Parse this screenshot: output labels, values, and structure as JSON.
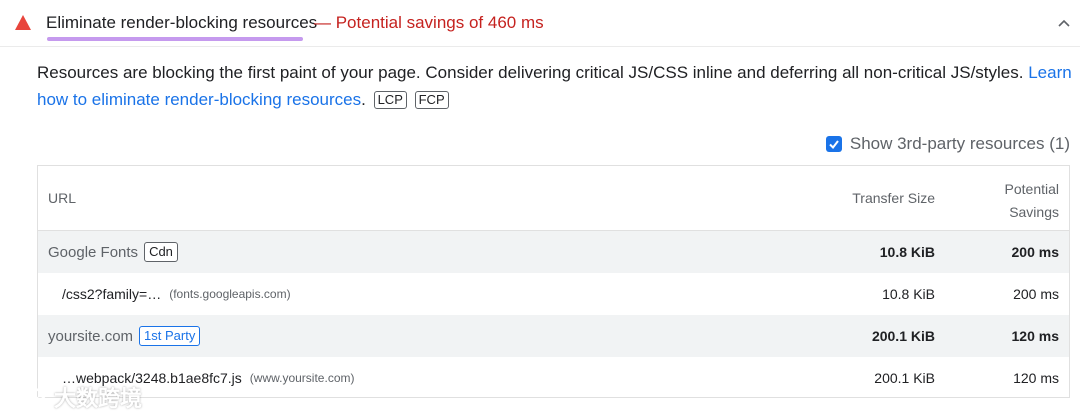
{
  "audit": {
    "title": "Eliminate render-blocking resources",
    "savings": "— Potential savings of 460 ms",
    "colors": {
      "warning": "#e8453c",
      "savings": "#c5221f",
      "underline": "#c59aee",
      "link": "#1a73e8"
    },
    "icons": {
      "status": "warning-triangle-icon",
      "toggle": "chevron-up-icon"
    }
  },
  "description": {
    "text": "Resources are blocking the first paint of your page. Consider delivering critical JS/CSS inline and deferring all non-critical JS/styles.",
    "link": "Learn how to eliminate render-blocking resources",
    "period": ".",
    "badges": [
      "LCP",
      "FCP"
    ]
  },
  "third_party": {
    "label": "Show 3rd-party resources (1)",
    "checked": true
  },
  "table": {
    "headers": {
      "url": "URL",
      "transfer_size": "Transfer Size",
      "savings_line1": "Potential",
      "savings_line2": "Savings"
    },
    "groups": [
      {
        "name": "Google Fonts",
        "badge": "Cdn",
        "transfer_size": "10.8 KiB",
        "savings": "200 ms",
        "items": [
          {
            "path": "/css2?family=…",
            "host": "(fonts.googleapis.com)",
            "transfer_size": "10.8 KiB",
            "savings": "200 ms"
          }
        ]
      },
      {
        "name": "yoursite.com",
        "badge": "1st Party",
        "transfer_size": "200.1 KiB",
        "savings": "120 ms",
        "items": [
          {
            "path": "…webpack/3248.b1ae8fc7.js",
            "host": "(www.yoursite.com)",
            "transfer_size": "200.1 KiB",
            "savings": "120 ms"
          }
        ]
      }
    ]
  },
  "watermark": {
    "text": "大数跨境"
  }
}
